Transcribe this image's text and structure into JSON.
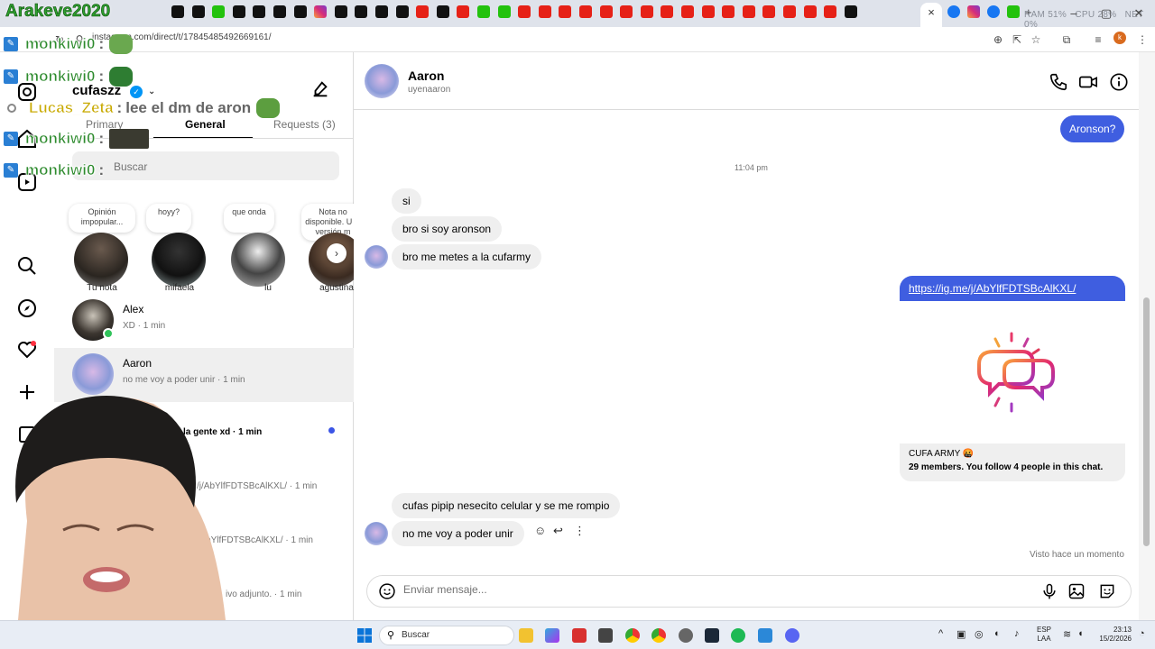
{
  "browser": {
    "url": "instagram.com/direct/t/17845485492669161/",
    "tab_close": "×",
    "tab_new": "+",
    "stats_ram": "RAM 51%",
    "stats_cpu": "CPU 28%",
    "stats_net": "NET 0%",
    "window_controls": [
      "–",
      "▢",
      "✕"
    ]
  },
  "stream_overlay": {
    "title": "Arakeve2020",
    "chat": [
      {
        "user": "monkiwi0",
        "sep": ":",
        "text": ""
      },
      {
        "user": "monkiwi0",
        "sep": ":",
        "text": ""
      },
      {
        "user": "Lucas_Zeta",
        "sep": ":",
        "text": "lee el dm de aron"
      },
      {
        "user": "monkiwi0",
        "sep": ":",
        "text": ""
      },
      {
        "user": "monkiwi0",
        "sep": ":",
        "text": ""
      }
    ]
  },
  "inbox": {
    "username": "cufaszz",
    "verified_mark": "✓",
    "tabs": [
      "Primary",
      "General",
      "Requests (3)"
    ],
    "active_tab": "General",
    "search_placeholder": "Buscar",
    "notes": [
      {
        "note": "Opinión impopular...",
        "name": "Tu nota"
      },
      {
        "note": "hoyy?",
        "name": "mifaela"
      },
      {
        "note": "que onda",
        "name": "lu"
      },
      {
        "note": "Nota no disponible. U la versión m",
        "name": "agustina"
      }
    ],
    "story_next": "›",
    "conversations": [
      {
        "name": "Alex",
        "preview": "XD · 1 min",
        "online": true
      },
      {
        "name": "Aaron",
        "preview": "no me voy a poder unir · 1 min",
        "active": true
      },
      {
        "name": "",
        "preview": "la gente xd · 1 min",
        "unread": true
      },
      {
        "name": "",
        "preview": "/j/AbYlfFDTSBcAlKXL/ · 1 min"
      },
      {
        "name": "",
        "preview": "e/j/AbYlfFDTSBcAlKXL/ · 1 min"
      },
      {
        "name": "",
        "preview": "ivo adjunto. · 1 min"
      }
    ]
  },
  "chat": {
    "name": "Aaron",
    "handle": "uyenaaron",
    "timestamp": "11:04 pm",
    "messages": [
      {
        "dir": "out",
        "text": "Aronson?"
      },
      {
        "dir": "in",
        "text": "si"
      },
      {
        "dir": "in",
        "text": "bro si soy aronson"
      },
      {
        "dir": "in",
        "text": "bro me metes a la cufarmy"
      },
      {
        "dir": "out",
        "text": "https://ig.me/j/AbYlfFDTSBcAlKXL/"
      },
      {
        "dir": "in",
        "text": "cufas pipip nesecito celular y se me rompio"
      },
      {
        "dir": "in",
        "text": "no me voy a poder unir"
      }
    ],
    "link_card": {
      "title": "CUFA ARMY 🤬",
      "subtitle": "29 members. You follow 4 people in this chat."
    },
    "seen": "Visto hace un momento",
    "composer_placeholder": "Enviar mensaje...",
    "msg_action_more": "⋮"
  },
  "taskbar": {
    "search_label": "Buscar",
    "lang": "ESP\nLAA",
    "time": "23:13",
    "date": "15/2/2026"
  },
  "colors": {
    "accent": "#3f5ee0",
    "bubble_in": "#efefef",
    "online": "#31c35b",
    "unread": "#3b55e6"
  }
}
